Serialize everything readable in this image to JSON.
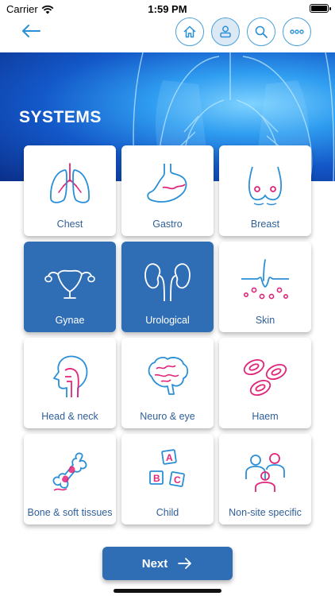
{
  "status_bar": {
    "carrier": "Carrier",
    "time": "1:59 PM"
  },
  "nav": {
    "back_icon": "arrow-left-icon",
    "buttons": [
      "home-icon",
      "profile-icon",
      "search-icon",
      "more-icon"
    ],
    "active_button": "profile-icon"
  },
  "banner": {
    "title": "SYSTEMS"
  },
  "colors": {
    "accent": "#2f6db5",
    "label": "#2f5f9a",
    "icon_blue": "#2a8fd6",
    "icon_pink": "#e0267a"
  },
  "systems": [
    {
      "label": "Chest",
      "icon": "lungs-icon",
      "selected": false
    },
    {
      "label": "Gastro",
      "icon": "stomach-icon",
      "selected": false
    },
    {
      "label": "Breast",
      "icon": "breast-icon",
      "selected": false
    },
    {
      "label": "Gynae",
      "icon": "uterus-icon",
      "selected": true
    },
    {
      "label": "Urological",
      "icon": "kidneys-icon",
      "selected": true
    },
    {
      "label": "Skin",
      "icon": "skin-icon",
      "selected": false
    },
    {
      "label": "Head & neck",
      "icon": "head-neck-icon",
      "selected": false
    },
    {
      "label": "Neuro & eye",
      "icon": "brain-icon",
      "selected": false
    },
    {
      "label": "Haem",
      "icon": "blood-cells-icon",
      "selected": false
    },
    {
      "label": "Bone & soft tissues",
      "icon": "bone-icon",
      "selected": false
    },
    {
      "label": "Child",
      "icon": "abc-blocks-icon",
      "selected": false
    },
    {
      "label": "Non-site specific",
      "icon": "group-icon",
      "selected": false
    }
  ],
  "next_button": {
    "label": "Next"
  }
}
